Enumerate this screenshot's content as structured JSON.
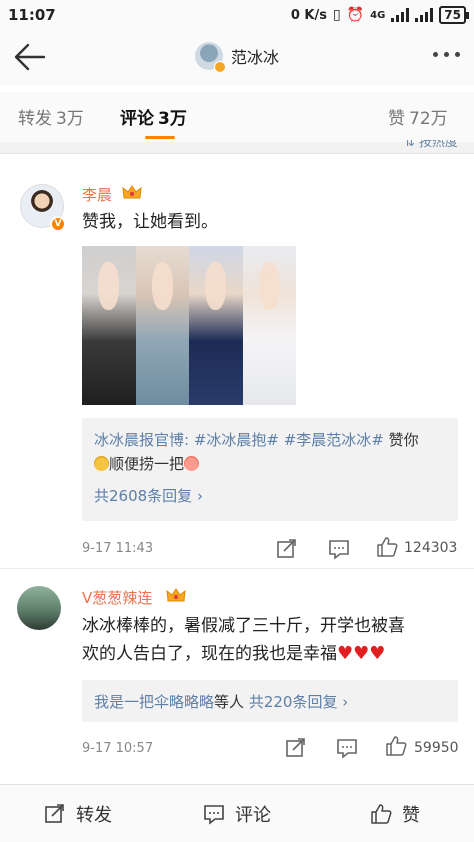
{
  "status_bar": {
    "time": "11:07",
    "speed": "0 K/s",
    "network": "4G",
    "battery": "75"
  },
  "header": {
    "title": "范冰冰"
  },
  "tabs": {
    "repost": {
      "label": "转发",
      "count": "3万"
    },
    "comments": {
      "label": "评论",
      "count": "3万"
    },
    "likes": {
      "label": "赞",
      "count": "72万"
    }
  },
  "sort_label": "按热度",
  "comments": [
    {
      "username": "李晨",
      "text": "赞我，让她看到。",
      "reply": {
        "tags": "冰冰晨报官博: #冰冰晨抱# #李晨范冰冰#",
        "tail": " 赞你",
        "line2": "顺便捞一把",
        "more": "共2608条回复 ›"
      },
      "time": "9-17 11:43",
      "likes": "124303"
    },
    {
      "username": "V葱葱辣连",
      "text_line1": "冰冰棒棒的，暑假减了三十斤，开学也被喜",
      "text_line2": "欢的人告白了，现在的我也是幸福",
      "reply": {
        "who": "我是一把伞略略略",
        "mid": "等人",
        "more": "共220条回复 ›"
      },
      "time": "9-17 10:57",
      "likes": "59950"
    }
  ],
  "toolbar": {
    "repost": "转发",
    "comment": "评论",
    "like": "赞"
  },
  "colors": {
    "accent": "#ff8200",
    "link": "#5d7fa8",
    "username": "#eb7350"
  }
}
